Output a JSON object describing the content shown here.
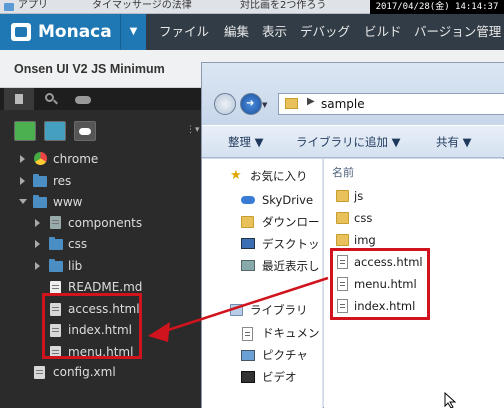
{
  "browser_tabs": [
    "アプリ",
    "タイマッサージの法律",
    "対比画を2つ作ろう"
  ],
  "clock_text": "2017/04/28(金) 14:14:37",
  "app": {
    "logo": "Monaca",
    "menu": [
      "ファイル",
      "編集",
      "表示",
      "デバッグ",
      "ビルド",
      "バージョン管理"
    ]
  },
  "project": {
    "title": "Onsen UI V2 JS Minimum"
  },
  "tree": {
    "chrome": "chrome",
    "res": "res",
    "www": "www",
    "components": "components",
    "css": "css",
    "lib": "lib",
    "readme": "README.md",
    "access": "access.html",
    "index": "index.html",
    "menu": "menu.html",
    "config": "config.xml"
  },
  "explorer": {
    "address": "sample",
    "commands": [
      "整理 ▼",
      "ライブラリに追加 ▼",
      "共有 ▼"
    ],
    "nav": {
      "favorites": "お気に入り",
      "skydrive": "SkyDrive",
      "downloads": "ダウンロー",
      "desktop": "デスクトッ",
      "recent": "最近表示し",
      "libraries": "ライブラリ",
      "documents": "ドキュメン",
      "pictures": "ピクチャ",
      "videos": "ビデオ"
    },
    "column_header": "名前",
    "files": [
      "js",
      "css",
      "img",
      "access.html",
      "menu.html",
      "index.html"
    ]
  },
  "colors": {
    "accent": "#1f78b4",
    "highlight": "#d0131c",
    "sidebar_bg": "#2b2b2b"
  }
}
